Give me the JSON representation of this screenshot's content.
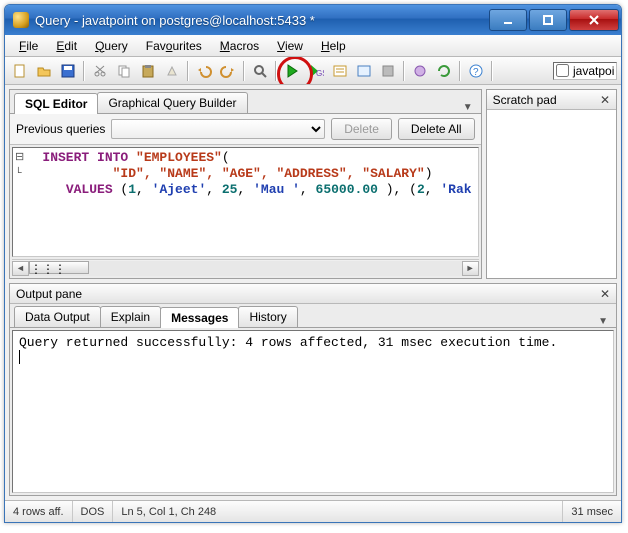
{
  "title": "Query - javatpoint on postgres@localhost:5433 *",
  "menu": {
    "file": "File",
    "edit": "Edit",
    "query": "Query",
    "favourites": "Favourites",
    "macros": "Macros",
    "view": "View",
    "help": "Help"
  },
  "toolbar_checkbox_label": "javatpoi",
  "editor_tabs": {
    "sql": "SQL Editor",
    "gqb": "Graphical Query Builder"
  },
  "prev_label": "Previous queries",
  "btn_delete": "Delete",
  "btn_delete_all": "Delete All",
  "sql": {
    "line1_a": "INSERT INTO ",
    "line1_b": "\"EMPLOYEES\"",
    "line1_c": "(",
    "line2_ids": "\"ID\", \"NAME\", \"AGE\", \"ADDRESS\", \"SALARY\"",
    "line2_end": ")",
    "line3_a": "VALUES ",
    "line3_b": "(",
    "line3_n1": "1",
    "line3_s1": "'Ajeet'",
    "line3_n2": "25",
    "line3_s2": "'Mau '",
    "line3_n3": "65000.00",
    "line3_c": " ), (",
    "line3_n4": "2",
    "line3_s3": "'Rak"
  },
  "scratch_title": "Scratch pad",
  "output_title": "Output pane",
  "output_tabs": {
    "data": "Data Output",
    "explain": "Explain",
    "messages": "Messages",
    "history": "History"
  },
  "message": "Query returned successfully: 4 rows affected, 31 msec execution time.",
  "status": {
    "rows": "4 rows aff.",
    "mode": "DOS",
    "pos": "Ln 5, Col 1, Ch 248",
    "time": "31 msec"
  }
}
